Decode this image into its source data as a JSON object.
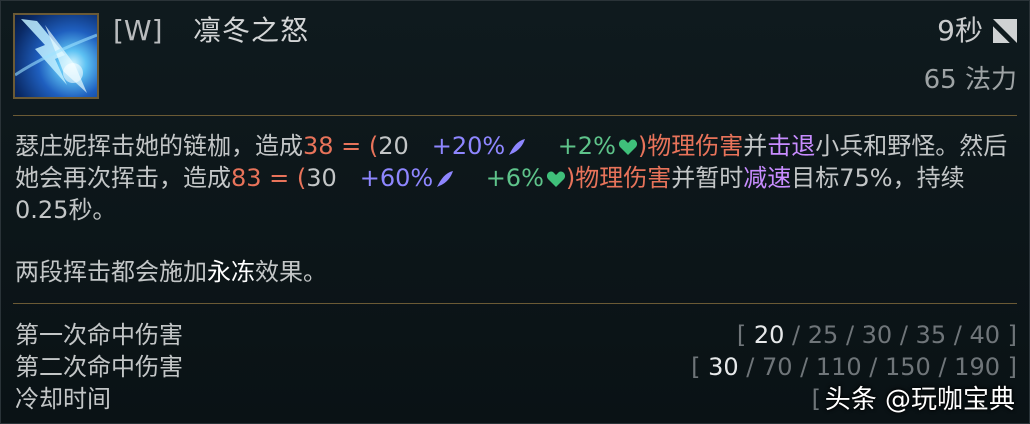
{
  "ability": {
    "hotkey": "[W]",
    "name": "凛冬之怒",
    "cooldown": "9秒",
    "cost": "65 法力",
    "icon": "frozen-flail-icon"
  },
  "description": {
    "line1_a": "瑟庄妮挥击她的链枷，造成",
    "hit1_dmg": "38 = (",
    "hit1_base": "20",
    "hit1_ad": "+20%",
    "hit1_armor": "+2%",
    "hit1_close": ")",
    "physical_1": "物理伤害",
    "and_1": "并",
    "knockback": "击退",
    "line1_b": "小兵和野怪。然后她会再次挥击，造成",
    "hit2_dmg": "83 = (",
    "hit2_base": "30",
    "hit2_ad": "+60%",
    "hit2_armor": "+6%",
    "hit2_close": ")",
    "physical_2": "物理伤害",
    "and_2": "并暂时",
    "slow": "减速",
    "line2_b": "目标75%，持续0.25秒。",
    "line3_a": "两段挥击都会施加",
    "permafrost": "永冻",
    "line3_b": "效果。"
  },
  "stats": {
    "row1": {
      "label": "第一次命中伤害",
      "open": "[",
      "v1": "20",
      "s1": " / ",
      "v2": "25",
      "s2": " / ",
      "v3": "30",
      "s3": " / ",
      "v4": "35",
      "s4": " / ",
      "v5": "40",
      "close": "]"
    },
    "row2": {
      "label": "第二次命中伤害",
      "open": "[",
      "v1": "30",
      "s1": " / ",
      "v2": "70",
      "s2": " / ",
      "v3": "110",
      "s3": " / ",
      "v4": "150",
      "s4": " / ",
      "v5": "190",
      "close": "]"
    },
    "row3": {
      "label": "冷却时间",
      "open": "["
    }
  },
  "watermark": "头条 @玩咖宝典",
  "colors": {
    "damage": "#e8735a",
    "ad_scaling": "#8e86ff",
    "armor_scaling": "#5ec38a",
    "keyword": "#c88cff",
    "divider": "#6b5a35"
  }
}
